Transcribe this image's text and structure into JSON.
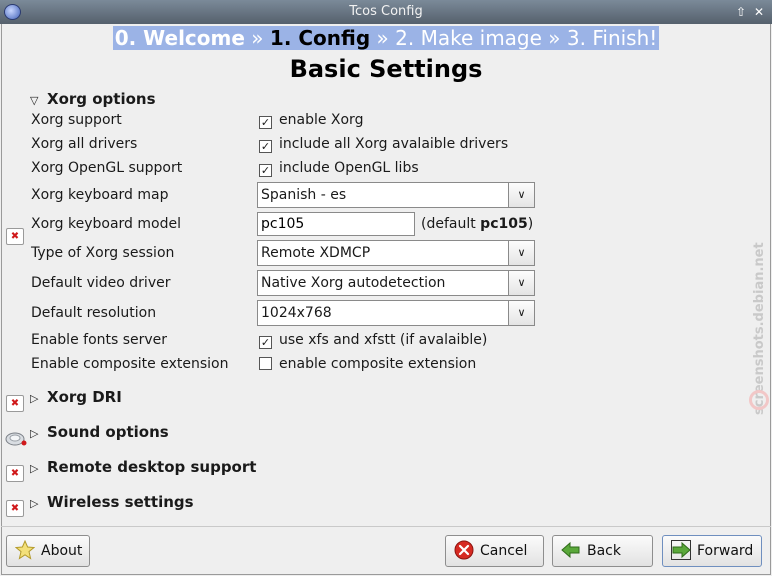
{
  "window": {
    "title": "Tcos Config",
    "controls": [
      "up-arrow",
      "close"
    ]
  },
  "wizard_steps": {
    "step0": "0. Welcome",
    "sep1": "»",
    "step1": "1. Config",
    "sep2": "»",
    "step2": "2. Make image",
    "sep3": "»",
    "step3": "3. Finish!"
  },
  "page_title": "Basic Settings",
  "xorg": {
    "section_label": "Xorg options",
    "support": {
      "label": "Xorg support",
      "check_label": "enable Xorg",
      "checked": true
    },
    "all_drivers": {
      "label": "Xorg all drivers",
      "check_label": "include all Xorg avalaible drivers",
      "checked": true
    },
    "opengl": {
      "label": "Xorg OpenGL support",
      "check_label": "include OpenGL libs",
      "checked": true
    },
    "keymap": {
      "label": "Xorg keyboard map",
      "value": "Spanish - es"
    },
    "keyboard_model": {
      "label": "Xorg keyboard model",
      "value": "pc105",
      "default_prefix": "(default ",
      "default_value": "pc105",
      "default_suffix": ")"
    },
    "session": {
      "label": "Type of Xorg session",
      "value": "Remote XDMCP"
    },
    "video_driver": {
      "label": "Default video driver",
      "value": "Native Xorg autodetection"
    },
    "resolution": {
      "label": "Default resolution",
      "value": "1024x768"
    },
    "fonts_server": {
      "label": "Enable fonts server",
      "check_label": "use xfs and xfstt (if avalaible)",
      "checked": true
    },
    "composite": {
      "label": "Enable composite extension",
      "check_label": "enable composite extension",
      "checked": false
    }
  },
  "sections": {
    "xorg_dri": "Xorg DRI",
    "sound": "Sound options",
    "remote_desktop": "Remote desktop support",
    "wireless": "Wireless settings"
  },
  "buttons": {
    "about": "About",
    "cancel": "Cancel",
    "back": "Back",
    "forward": "Forward"
  },
  "watermark": "screenshots.debian.net",
  "colors": {
    "steps_bg": "#9bb3e6",
    "titlebar": "#66727f",
    "error_icon": "#d0191b"
  }
}
